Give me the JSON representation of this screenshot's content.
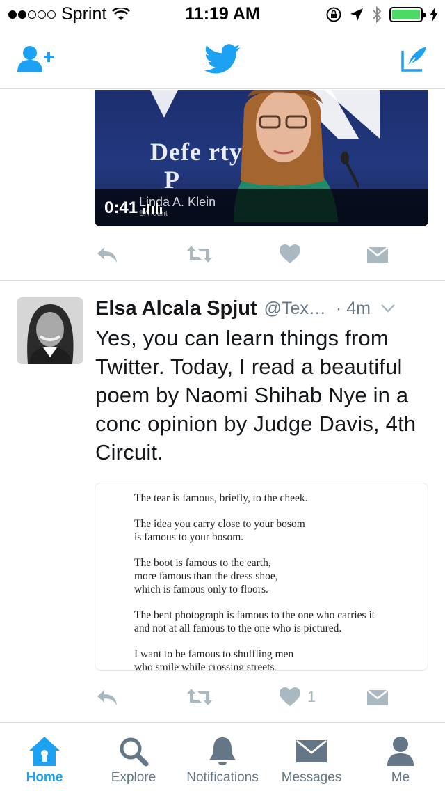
{
  "status_bar": {
    "carrier": "Sprint",
    "time": "11:19 AM"
  },
  "nav": {
    "left_icon": "add-user-icon",
    "center_icon": "twitter-bird-icon",
    "right_icon": "compose-icon"
  },
  "video_tweet": {
    "wall_text": "Defe    rty",
    "wall_text2": "P",
    "lower_third_name": "Linda A. Klein",
    "lower_third_sub": "BA  ident",
    "duration": "0:41"
  },
  "tweet": {
    "author": "Elsa Alcala Spjut",
    "handle": "@Tex…",
    "time": "· 4m",
    "text": "Yes, you can learn things from Twitter. Today, I read a beautiful poem by Naomi Shihab Nye in a conc opinion by Judge Davis, 4th Circuit.",
    "like_count": "1",
    "poem_lines": [
      "The tear is famous, briefly, to the cheek.",
      "The idea you carry close to your bosom\nis famous to your bosom.",
      "The boot is famous to the earth,\nmore famous than the dress shoe,\nwhich is famous only to floors.",
      "The bent photograph is famous to the one who carries it\nand not at all famous to the one who is pictured.",
      "I want to be famous to shuffling men\nwho smile while crossing streets,"
    ]
  },
  "tabs": [
    {
      "label": "Home",
      "icon": "home-icon",
      "active": true
    },
    {
      "label": "Explore",
      "icon": "search-icon",
      "active": false
    },
    {
      "label": "Notifications",
      "icon": "bell-icon",
      "active": false
    },
    {
      "label": "Messages",
      "icon": "envelope-icon",
      "active": false
    },
    {
      "label": "Me",
      "icon": "person-icon",
      "active": false
    }
  ],
  "colors": {
    "brand": "#1da1f2",
    "muted": "#657786",
    "action_gray": "#aab8c2",
    "battery": "#4cd964"
  }
}
